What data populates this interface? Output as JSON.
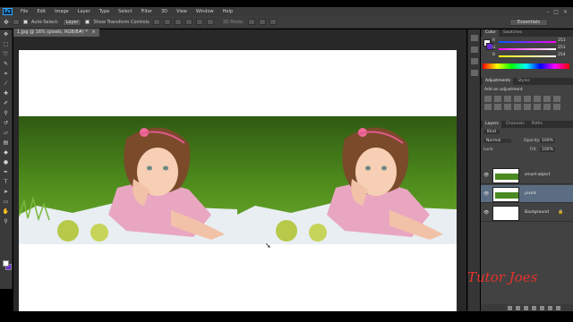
{
  "app": {
    "logo": "Ps"
  },
  "menubar": {
    "items": [
      "File",
      "Edit",
      "Image",
      "Layer",
      "Type",
      "Select",
      "Filter",
      "3D",
      "View",
      "Window",
      "Help"
    ],
    "window_controls": [
      "–",
      "□",
      "×"
    ]
  },
  "options": {
    "auto_select": "Auto-Select:",
    "auto_select_value": "Layer",
    "show_transform": "Show Transform Controls",
    "mode_3d": "3D Mode:",
    "workspace": "Essentials"
  },
  "document": {
    "tab_title": "1.jpg @ 16% (pixels, RGB/8#) *",
    "tab_close": "×"
  },
  "panels": {
    "color_tabs": [
      "Color",
      "Swatches"
    ],
    "color_labels": [
      "R",
      "G",
      "B"
    ],
    "color_values": [
      "251",
      "251",
      "254"
    ],
    "adjust_tabs": [
      "Adjustments",
      "Styles"
    ],
    "adjust_title": "Add an adjustment",
    "layer_tabs": [
      "Layers",
      "Channels",
      "Paths"
    ],
    "kind": "Kind",
    "blend": "Normal",
    "opacity_label": "Opacity:",
    "opacity": "100%",
    "lock_label": "Lock:",
    "fill_label": "Fill:",
    "fill": "100%",
    "layers": [
      {
        "name": "smart object"
      },
      {
        "name": "pixels"
      },
      {
        "name": "Background"
      }
    ]
  },
  "watermark": "Tutor Joes",
  "colors": {
    "accent": "#31a8ff",
    "selected_layer": "#5b6d82",
    "watermark": "#e8322a"
  }
}
